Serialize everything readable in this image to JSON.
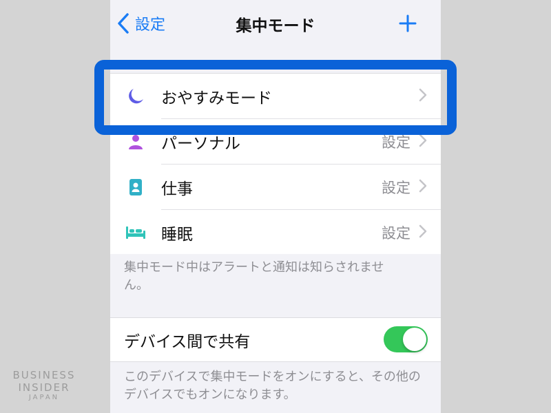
{
  "nav": {
    "back_label": "設定",
    "title": "集中モード"
  },
  "focus_modes": [
    {
      "label": "おやすみモード",
      "detail": "",
      "icon": "moon-icon",
      "color": "#5e5ce6"
    },
    {
      "label": "パーソナル",
      "detail": "設定",
      "icon": "person-icon",
      "color": "#af52de"
    },
    {
      "label": "仕事",
      "detail": "設定",
      "icon": "id-badge-icon",
      "color": "#30b0c7"
    },
    {
      "label": "睡眠",
      "detail": "設定",
      "icon": "bed-icon",
      "color": "#30c4b9"
    }
  ],
  "focus_footer": "集中モード中はアラートと通知は知らされません。",
  "share": {
    "label": "デバイス間で共有",
    "enabled": true,
    "footer": "このデバイスで集中モードをオンにすると、その他のデバイスでもオンになります。"
  },
  "watermark": {
    "line1": "BUSINESS",
    "line2": "INSIDER",
    "line3": "JAPAN"
  },
  "colors": {
    "accent": "#1a7cf5",
    "toggle_on": "#34c759",
    "highlight": "#0a62d8"
  }
}
